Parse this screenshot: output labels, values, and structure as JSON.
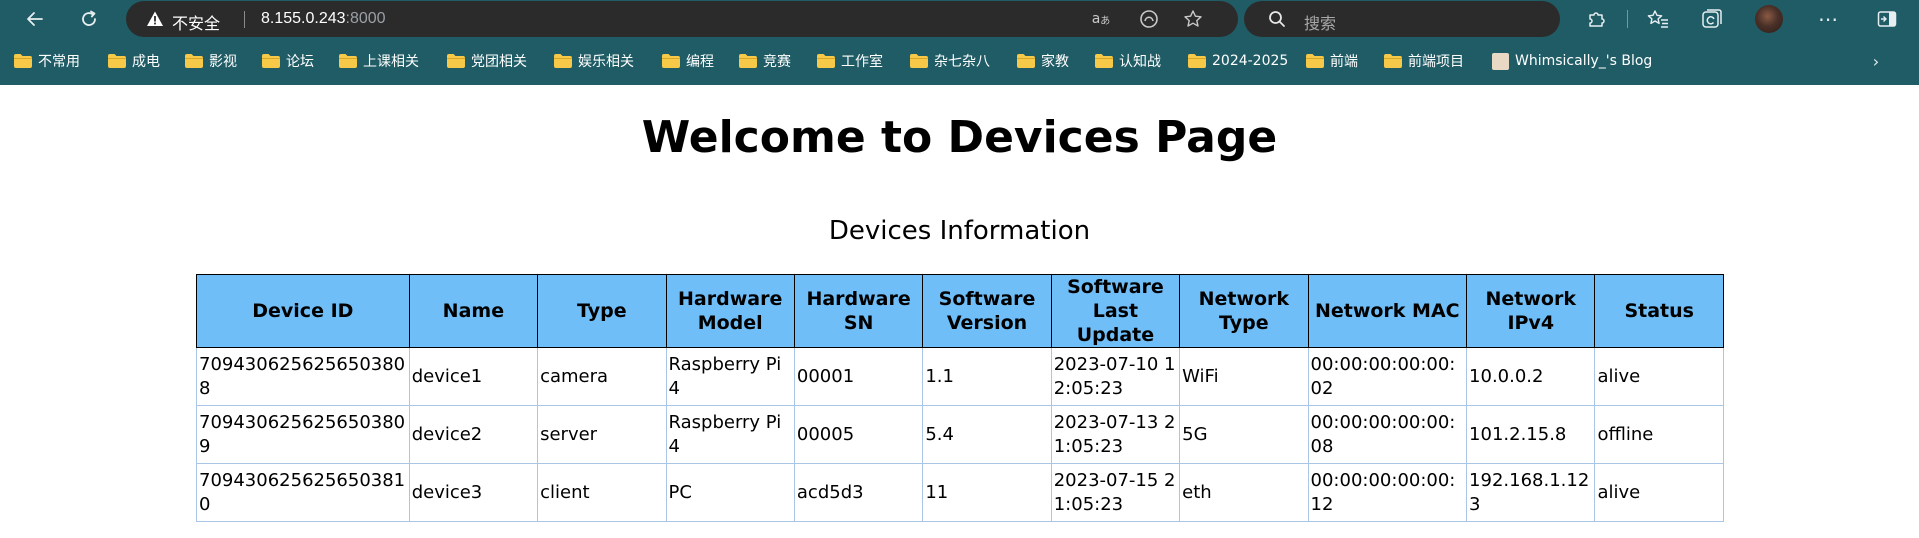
{
  "browser": {
    "address": {
      "security_label": "不安全",
      "host": "8.155.0.243",
      "port": ":8000"
    },
    "search": {
      "placeholder": "搜索"
    },
    "bookmarks": [
      {
        "label": "不常用",
        "type": "folder"
      },
      {
        "label": "成电",
        "type": "folder"
      },
      {
        "label": "影视",
        "type": "folder"
      },
      {
        "label": "论坛",
        "type": "folder"
      },
      {
        "label": "上课相关",
        "type": "folder"
      },
      {
        "label": "党团相关",
        "type": "folder"
      },
      {
        "label": "娱乐相关",
        "type": "folder"
      },
      {
        "label": "编程",
        "type": "folder"
      },
      {
        "label": "竞赛",
        "type": "folder"
      },
      {
        "label": "工作室",
        "type": "folder"
      },
      {
        "label": "杂七杂八",
        "type": "folder"
      },
      {
        "label": "家教",
        "type": "folder"
      },
      {
        "label": "认知战",
        "type": "folder"
      },
      {
        "label": "2024-2025",
        "type": "folder"
      },
      {
        "label": "前端",
        "type": "folder"
      },
      {
        "label": "前端项目",
        "type": "folder"
      },
      {
        "label": "Whimsically_'s Blog",
        "type": "site"
      }
    ],
    "colors": {
      "chrome": "#1f5c66",
      "omnibox": "#2b2b2b",
      "folder": "#f7c948"
    }
  },
  "page": {
    "title": "Welcome to Devices Page",
    "section_title": "Devices Information",
    "colors": {
      "header_bg": "#6fbef8",
      "cell_border": "#a9c6e6"
    }
  },
  "table": {
    "headers": [
      "Device ID",
      "Name",
      "Type",
      "Hardware Model",
      "Hardware SN",
      "Software Version",
      "Software Last Update",
      "Network Type",
      "Network MAC",
      "Network IPv4",
      "Status"
    ],
    "rows": [
      [
        "7094306256256503808",
        "device1",
        "camera",
        "Raspberry Pi 4",
        "00001",
        "1.1",
        "2023-07-10 12:05:23",
        "WiFi",
        "00:00:00:00:00:02",
        "10.0.0.2",
        "alive"
      ],
      [
        "7094306256256503809",
        "device2",
        "server",
        "Raspberry Pi 4",
        "00005",
        "5.4",
        "2023-07-13 21:05:23",
        "5G",
        "00:00:00:00:00:08",
        "101.2.15.8",
        "offline"
      ],
      [
        "7094306256256503810",
        "device3",
        "client",
        "PC",
        "acd5d3",
        "11",
        "2023-07-15 21:05:23",
        "eth",
        "00:00:00:00:00:12",
        "192.168.1.123",
        "alive"
      ]
    ]
  }
}
